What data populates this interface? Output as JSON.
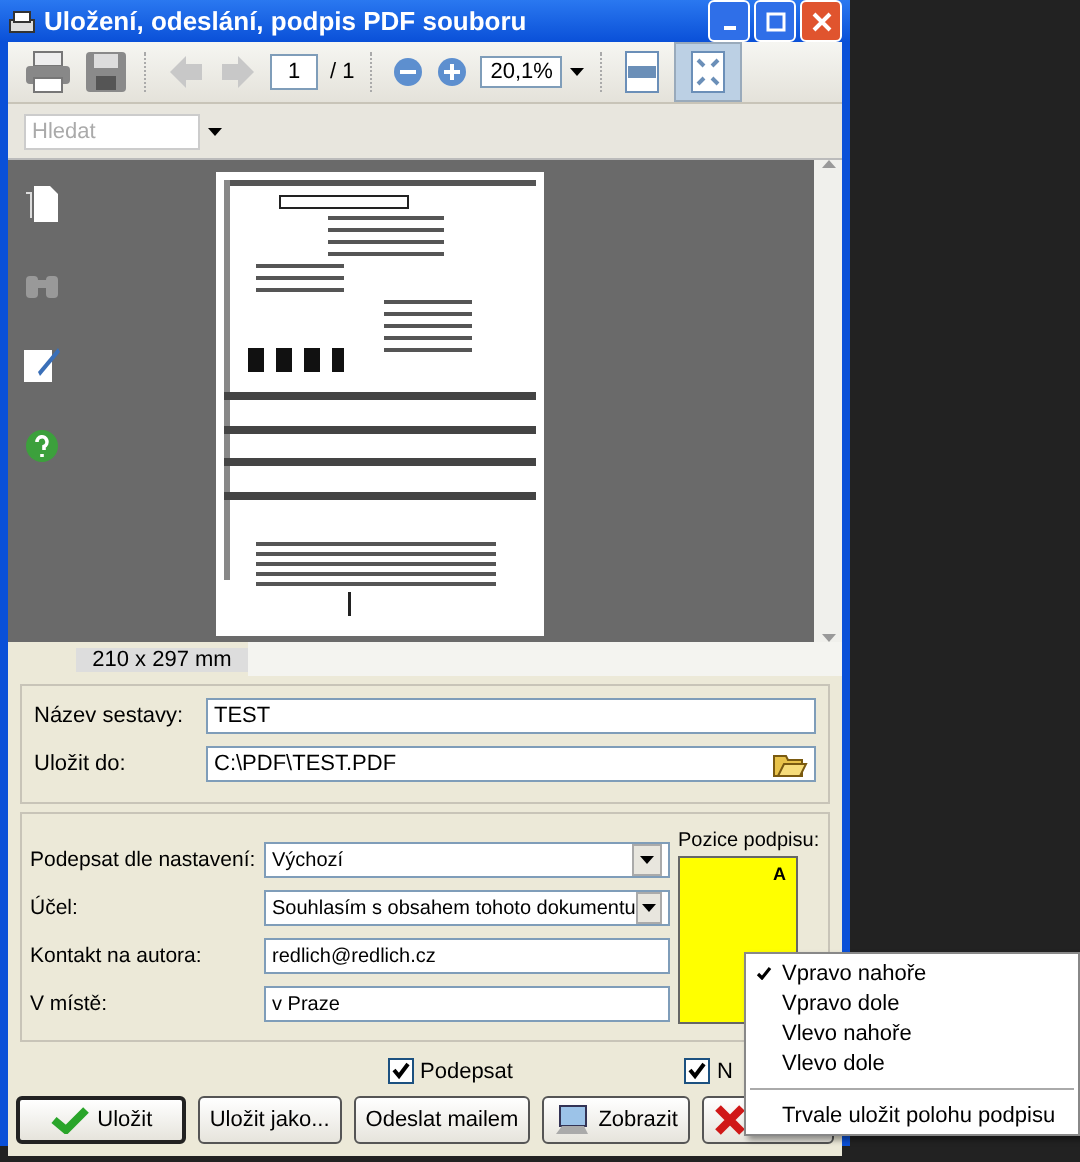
{
  "window": {
    "title": "Uložení, odeslání, podpis PDF souboru"
  },
  "toolbar": {
    "page": "1",
    "page_total": "/ 1",
    "zoom": "20,1%",
    "fit_page_active": true
  },
  "search": {
    "placeholder": "Hledat"
  },
  "preview": {
    "page_size": "210 x 297 mm"
  },
  "output": [
    {
      "label": "Název sestavy:",
      "value": "TEST",
      "kind": "text"
    },
    {
      "label": "Uložit do:",
      "value": "C:\\PDF\\TEST.PDF",
      "kind": "path"
    }
  ],
  "signature": {
    "rows": [
      {
        "label": "Podepsat dle nastavení:",
        "value": "Výchozí",
        "kind": "select"
      },
      {
        "label": "Účel:",
        "value": "Souhlasím s obsahem tohoto dokumentu",
        "kind": "select"
      },
      {
        "label": "Kontakt na autora:",
        "value": "redlich@redlich.cz",
        "kind": "text"
      },
      {
        "label": "V místě:",
        "value": "v Praze",
        "kind": "text"
      }
    ],
    "position_label": "Pozice podpisu:",
    "position_mark": "A"
  },
  "checkboxes": [
    {
      "label": "Podepsat",
      "checked": true
    },
    {
      "label": "N",
      "checked": true
    }
  ],
  "buttons": [
    {
      "label": "Uložit",
      "kind": "save",
      "default": true
    },
    {
      "label": "Uložit jako...",
      "kind": "plain",
      "default": false
    },
    {
      "label": "Odeslat mailem",
      "kind": "plain",
      "default": false
    },
    {
      "label": "Zobrazit",
      "kind": "view",
      "default": false
    },
    {
      "kind": "cancel",
      "default": false
    }
  ],
  "menu": [
    {
      "kind": "item",
      "label": "Vpravo nahoře",
      "checked": true
    },
    {
      "kind": "item",
      "label": "Vpravo dole",
      "checked": false
    },
    {
      "kind": "item",
      "label": "Vlevo nahoře",
      "checked": false
    },
    {
      "kind": "item",
      "label": "Vlevo dole",
      "checked": false
    },
    {
      "kind": "separator"
    },
    {
      "kind": "item",
      "label": "Trvale uložit polohu podpisu",
      "checked": false
    }
  ]
}
